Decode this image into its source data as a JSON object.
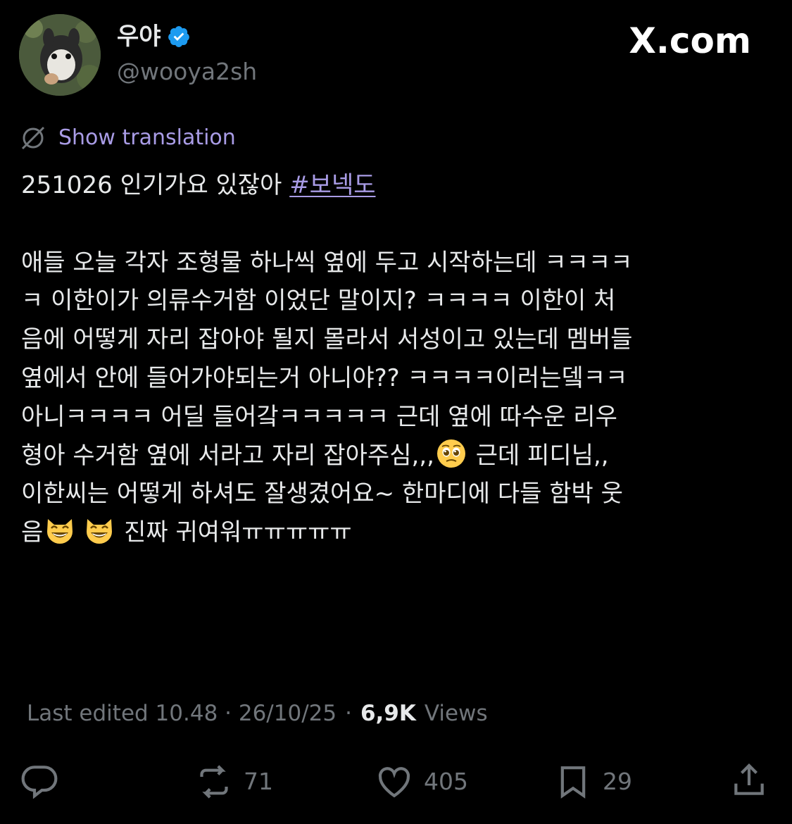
{
  "user": {
    "display_name": "우야",
    "handle": "@wooya2sh",
    "verified": true
  },
  "brand": "X.com",
  "translate": {
    "label": "Show translation"
  },
  "tweet": {
    "first_line_text": "251026 인기가요 있잖아 ",
    "hashtag": "#보넥도",
    "lines": [
      "애들 오늘 각자 조형물 하나씩 옆에 두고 시작하는데 ㅋㅋㅋㅋ",
      "ㅋ 이한이가 의류수거함 이었단 말이지? ㅋㅋㅋㅋ 이한이 처",
      "음에 어떻게 자리 잡아야 될지 몰라서 서성이고 있는데 멤버들",
      "옆에서 안에 들어가야되는거 아니야?? ㅋㅋㅋㅋ이러는뎈ㅋㅋ",
      "아니ㅋㅋㅋㅋ 어딜 들어갘ㅋㅋㅋㅋㅋ 근데 옆에 따수운 리우",
      "형아 수거함 옆에 서라고 자리 잡아주심,,,",
      " 근데 피디님,,",
      "이한씨는 어떻게 하셔도 잘생겼어요~ 한마디에 다들 함박 웃",
      "음",
      " 진짜 귀여워ㅠㅠㅠㅠㅠ"
    ],
    "emojis": [
      "pleading-face-emoji",
      "grinning-cat-emoji"
    ]
  },
  "meta": {
    "edited": "Last edited 10.48 · 26/10/25",
    "separator": "·",
    "views_count": "6,9K",
    "views_label": "Views"
  },
  "actions": {
    "reply": {
      "icon": "reply-icon"
    },
    "repost": {
      "icon": "repost-icon",
      "count": "71"
    },
    "like": {
      "icon": "heart-icon",
      "count": "405"
    },
    "bookmark": {
      "icon": "bookmark-icon",
      "count": "29"
    },
    "share": {
      "icon": "share-icon"
    }
  },
  "colors": {
    "background": "#000000",
    "text": "#e7e9ea",
    "muted": "#71767b",
    "link": "#a99ce6",
    "verified": "#1d9bf0"
  }
}
